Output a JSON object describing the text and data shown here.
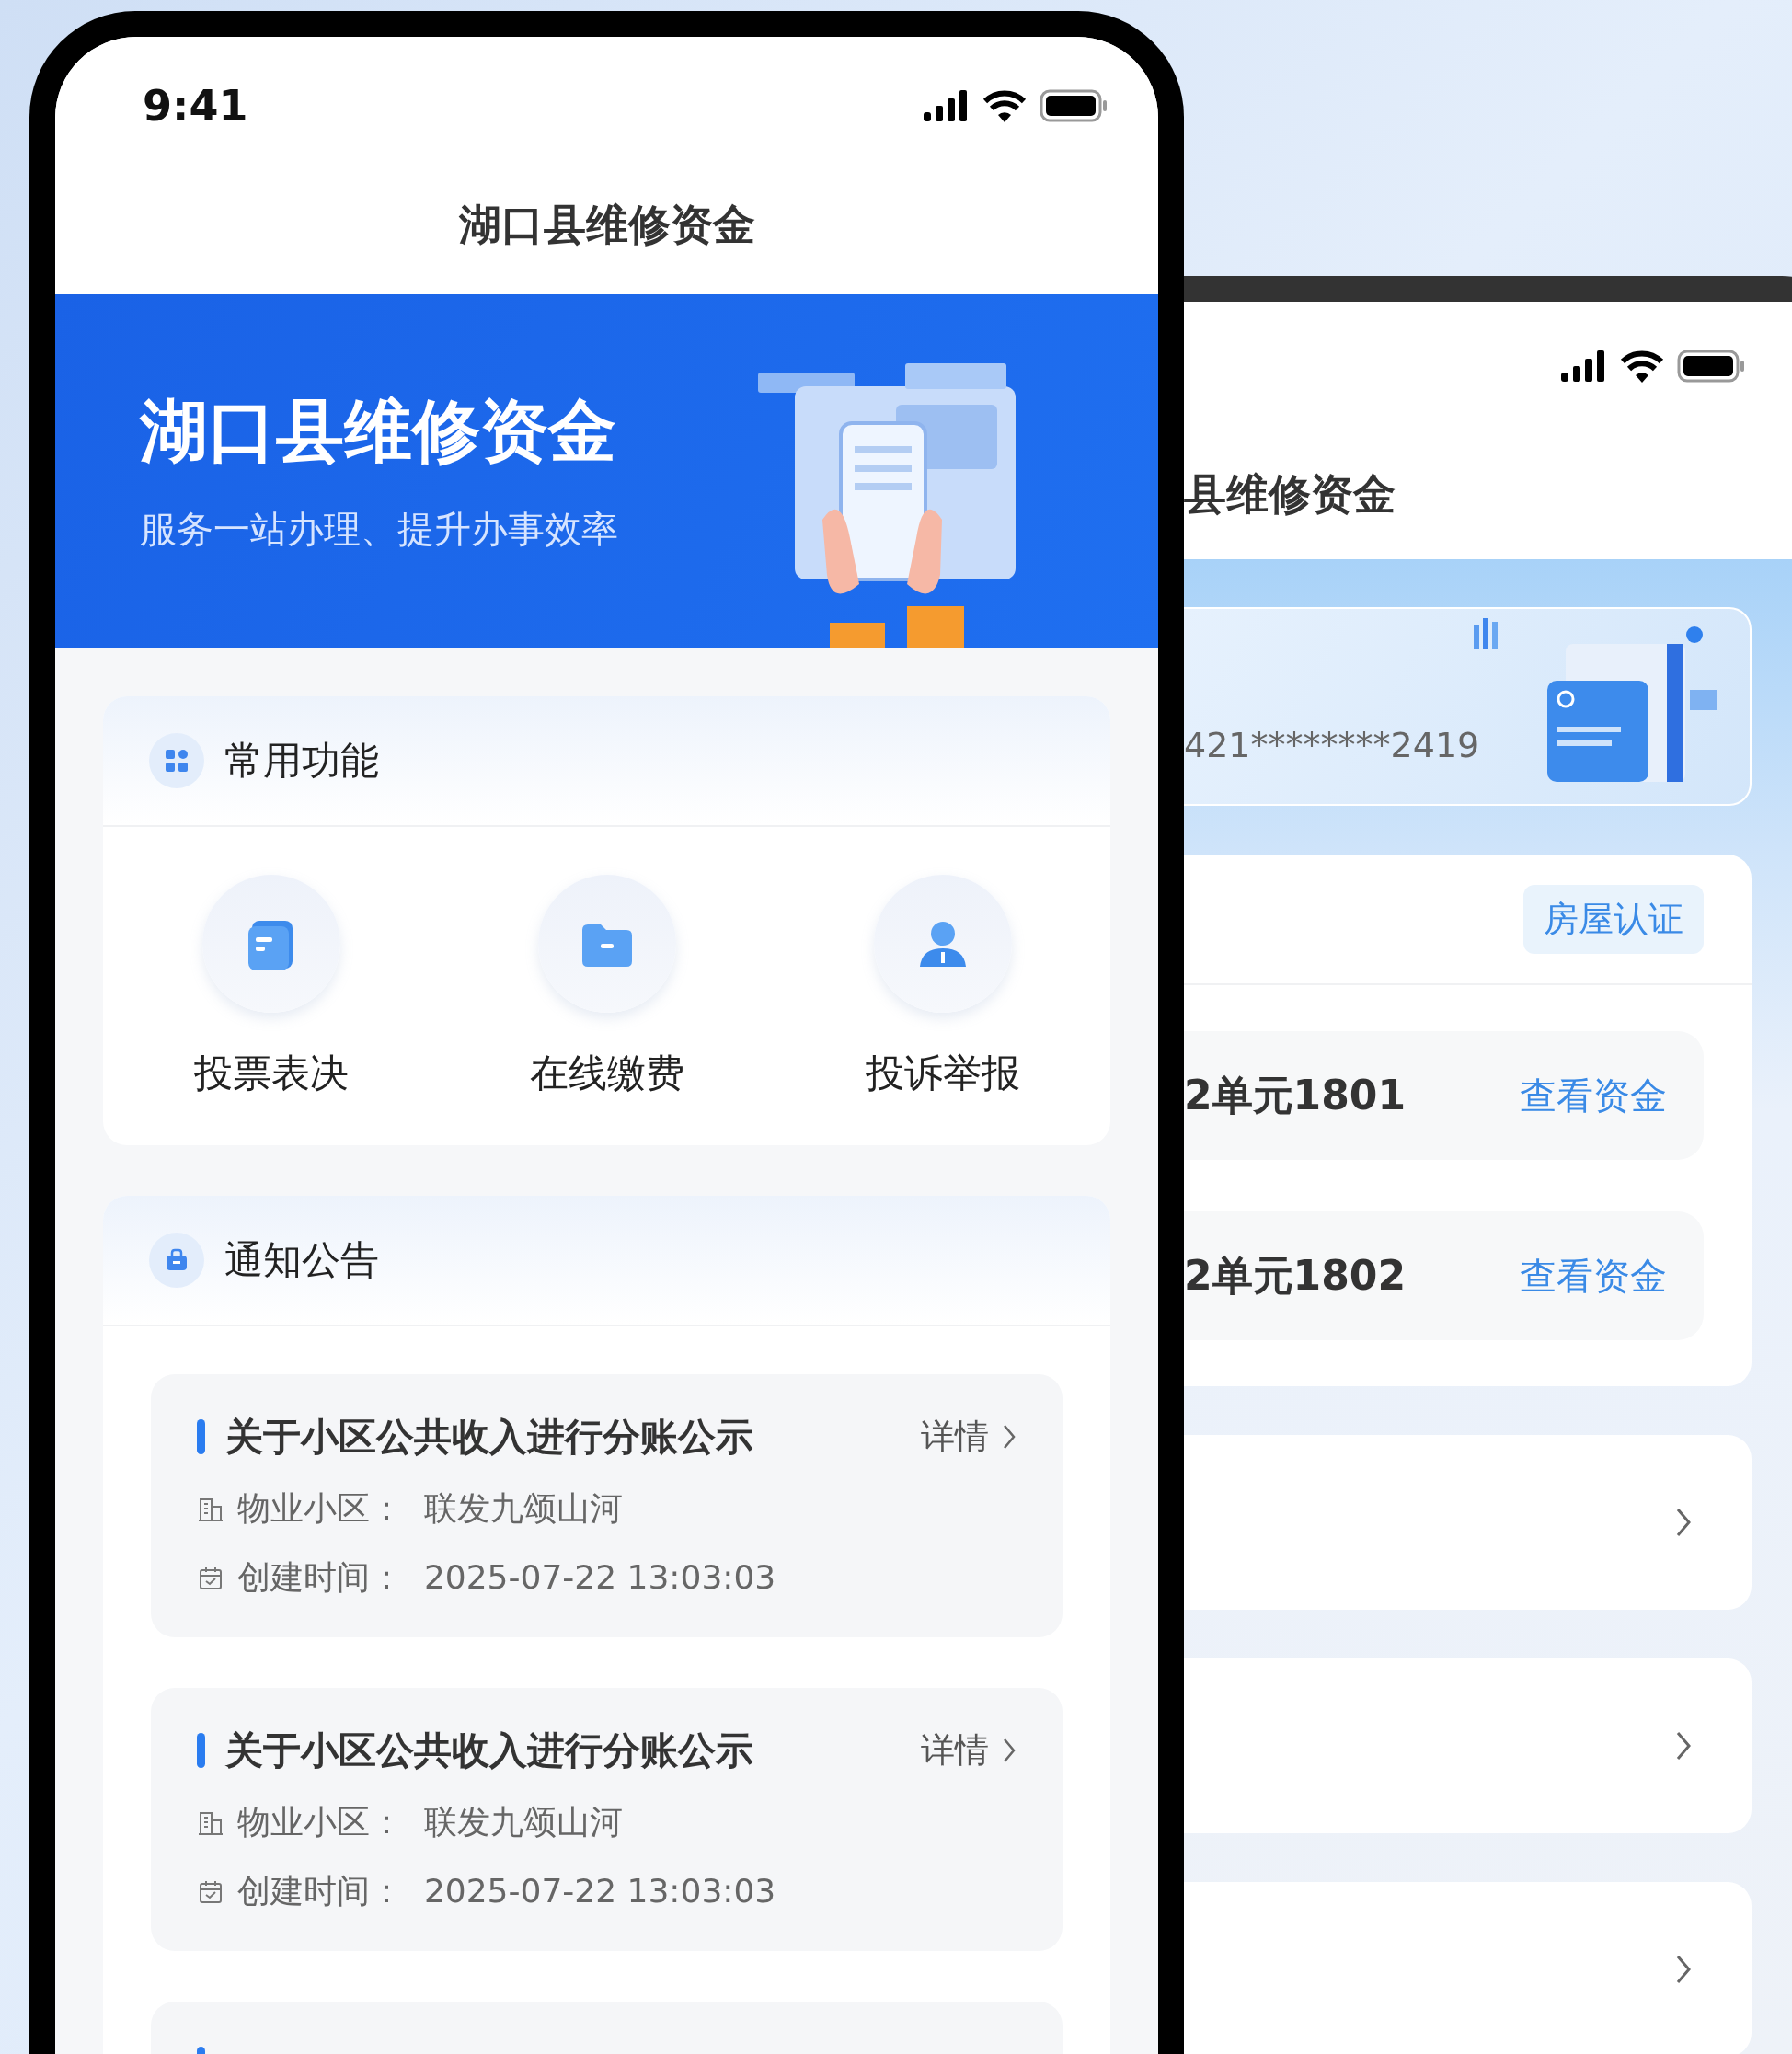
{
  "front_phone": {
    "status_bar": {
      "time": "9:41"
    },
    "title": "湖口县维修资金",
    "banner": {
      "heading": "湖口县维修资金",
      "subtitle": "服务一站办理、提升办事效率"
    },
    "functions": {
      "title": "常用功能",
      "items": [
        {
          "label": "投票表决",
          "kind": "document"
        },
        {
          "label": "在线缴费",
          "kind": "folder"
        },
        {
          "label": "投诉举报",
          "kind": "person"
        }
      ]
    },
    "notices": {
      "title": "通知公告",
      "items": [
        {
          "kind": "full",
          "title": "关于小区公共收入进行分账公示",
          "action": "详情",
          "community_label": "物业小区：",
          "community": "联发九颂山河",
          "created_label": "创建时间：",
          "created": "2025-07-22 13:03:03"
        },
        {
          "kind": "full",
          "title": "关于小区公共收入进行分账公示",
          "action": "详情",
          "community_label": "物业小区：",
          "community": "联发九颂山河",
          "created_label": "创建时间：",
          "created": "2025-07-22 13:03:03"
        },
        {
          "kind": "clipped"
        }
      ]
    }
  },
  "back_phone": {
    "title": "县维修资金",
    "card_number": "421********2419",
    "certify_button": "房屋认证",
    "houses": [
      {
        "name": "2单元1801",
        "action": "查看资金"
      },
      {
        "name": "2单元1802",
        "action": "查看资金"
      }
    ],
    "menu_rows": [
      {
        "kind": "chevron"
      },
      {
        "kind": "chevron"
      },
      {
        "kind": "chevron"
      }
    ]
  }
}
